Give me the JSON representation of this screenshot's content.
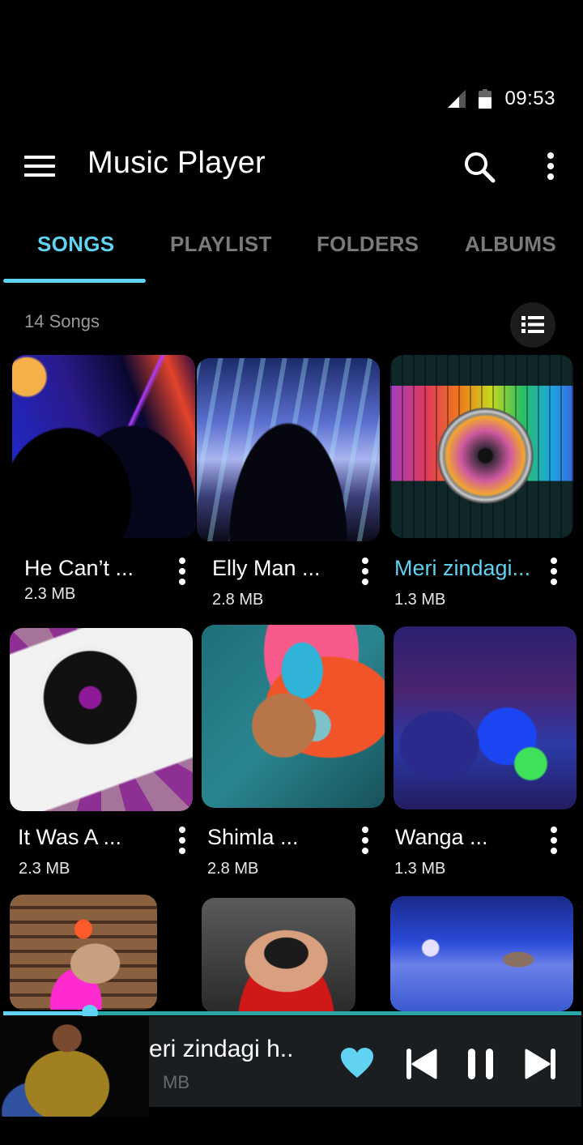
{
  "status_bar": {
    "time": "09:53",
    "signal_icon": "cell-signal-icon",
    "battery_icon": "battery-icon"
  },
  "app_bar": {
    "title": "Music Player",
    "menu_icon": "hamburger-menu-icon",
    "search_icon": "search-icon",
    "more_icon": "more-vert-icon"
  },
  "tabs": [
    {
      "label": "SONGS",
      "active": true
    },
    {
      "label": "PLAYLIST",
      "active": false
    },
    {
      "label": "FOLDERS",
      "active": false
    },
    {
      "label": "ALBUMS",
      "active": false
    }
  ],
  "songs_header": {
    "count_label": "14 Songs",
    "view_toggle_icon": "list-view-icon"
  },
  "songs": [
    {
      "title": "He Can’t ...",
      "size": "2.3 MB",
      "playing": false,
      "art": "laser-party"
    },
    {
      "title": "Elly Man ...",
      "size": "2.8 MB",
      "playing": false,
      "art": "concert-crowd"
    },
    {
      "title": "Meri zindagi...",
      "size": "1.3 MB",
      "playing": true,
      "art": "speaker-equalizer"
    },
    {
      "title": "It Was A ...",
      "size": "2.3 MB",
      "playing": false,
      "art": "turntable"
    },
    {
      "title": "Shimla ...",
      "size": "2.8 MB",
      "playing": false,
      "art": "woman-headphones"
    },
    {
      "title": "Wanga ...",
      "size": "1.3 MB",
      "playing": false,
      "art": "neon-dancers"
    },
    {
      "title": "",
      "size": "",
      "playing": false,
      "art": "girl-wood-wall"
    },
    {
      "title": "",
      "size": "",
      "playing": false,
      "art": "man-goggles"
    },
    {
      "title": "",
      "size": "",
      "playing": false,
      "art": "stage-heels"
    }
  ],
  "now_playing": {
    "title": "eri zindagi h..",
    "size": "MB",
    "progress_percent": 15,
    "favorite": true,
    "heart_icon": "favorite-heart-icon",
    "prev_icon": "skip-previous-icon",
    "pause_icon": "pause-icon",
    "next_icon": "skip-next-icon"
  },
  "colors": {
    "accent": "#5fd3f1",
    "background": "#000000",
    "tab_inactive": "#7a7a7a",
    "mini_player_bg": "#1b1e21",
    "progress_track": "#2aa6a6"
  }
}
